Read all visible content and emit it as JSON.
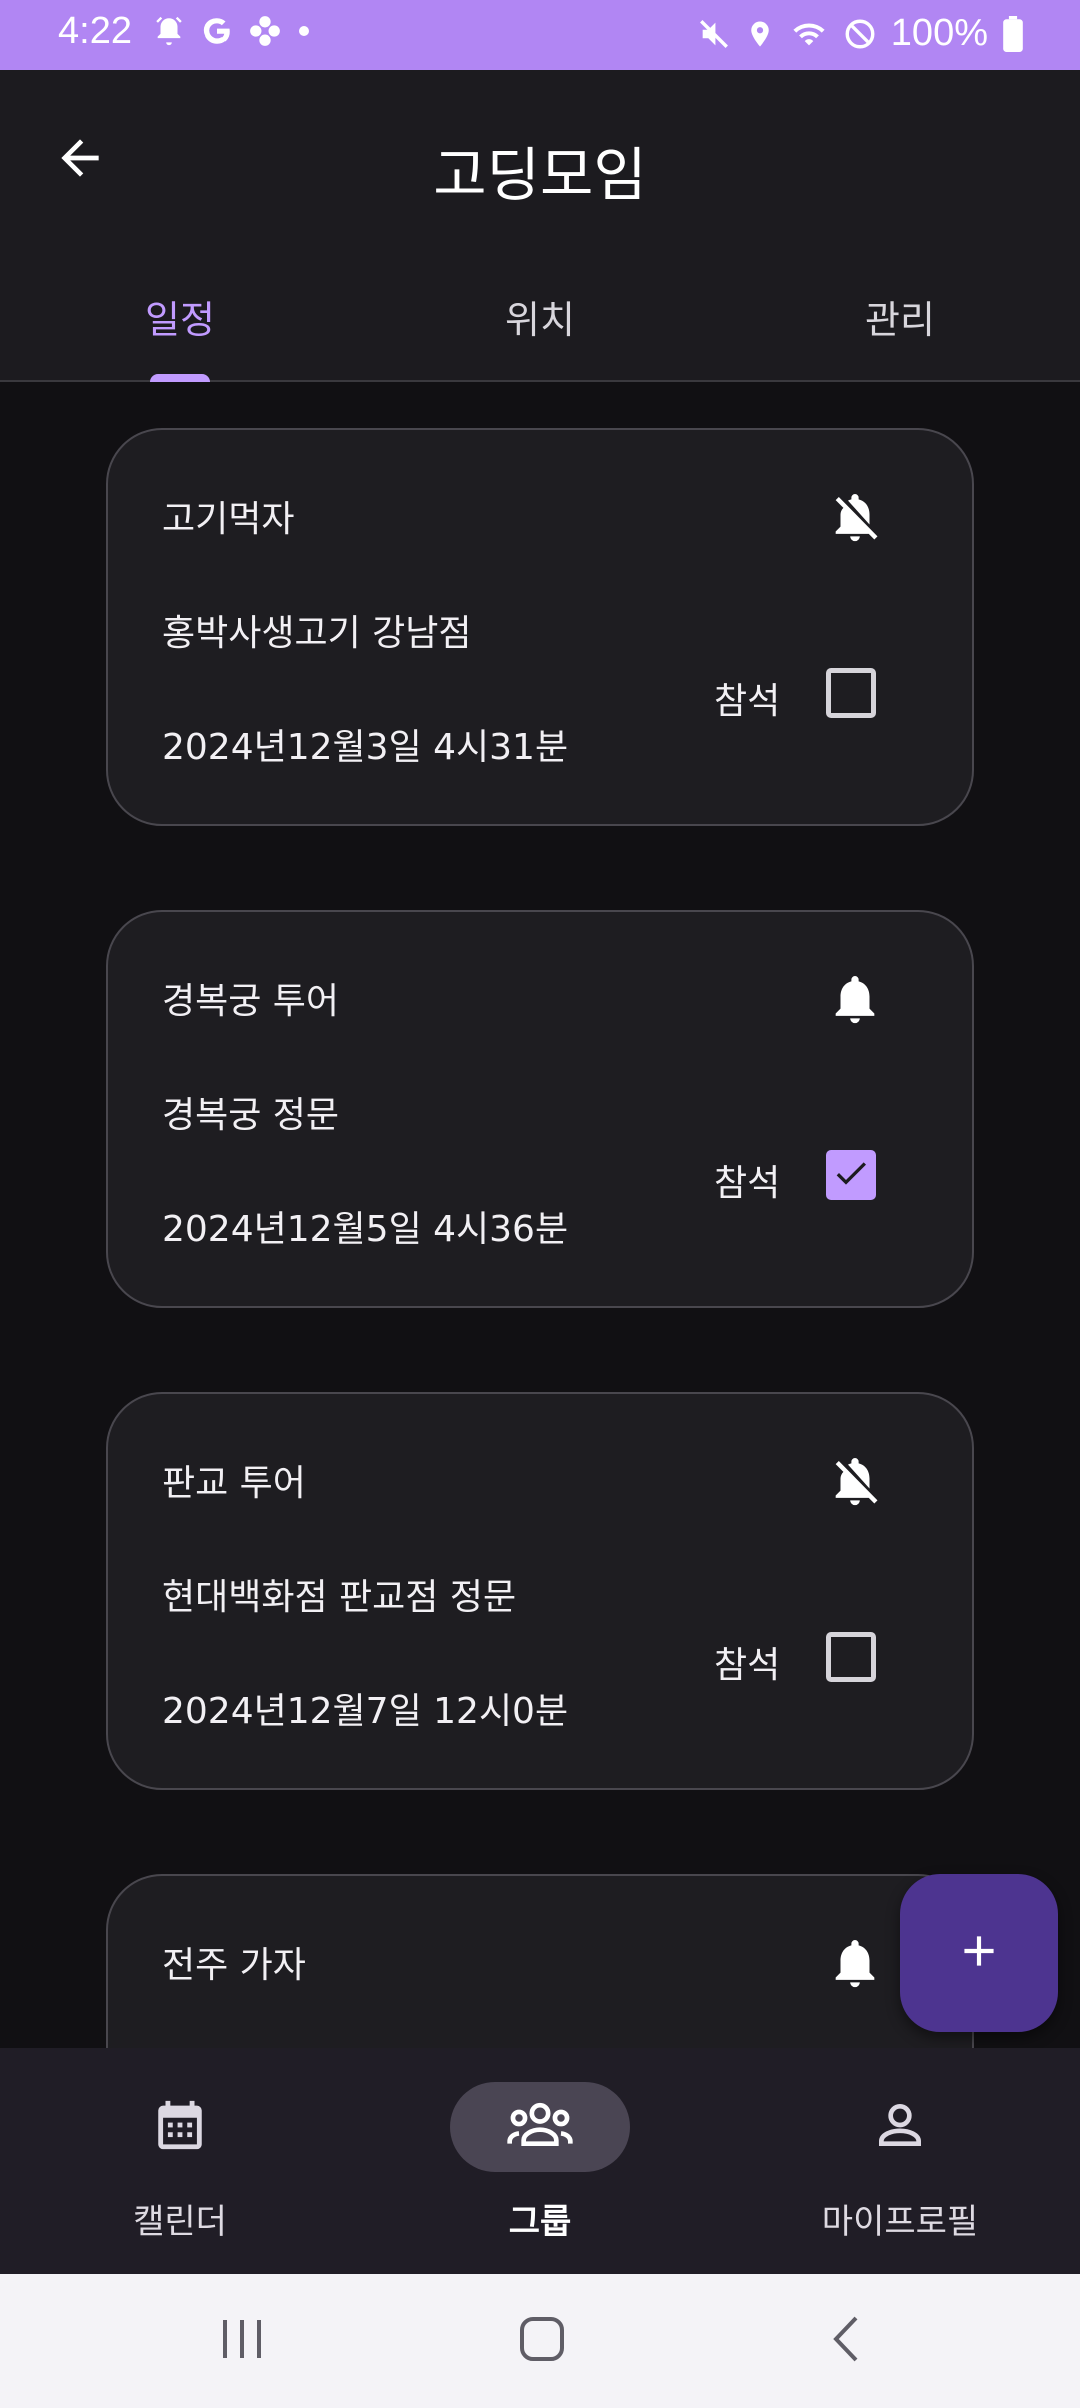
{
  "status_bar": {
    "time": "4:22",
    "battery": "100%",
    "left_icons": [
      "alarm-icon",
      "google-icon",
      "pinwheel-icon",
      "dot-icon"
    ],
    "right_icons": [
      "mute-icon",
      "location-icon",
      "wifi-icon",
      "dnd-icon",
      "battery-icon"
    ]
  },
  "header": {
    "title": "고딩모임",
    "back_icon": "arrow-left-icon"
  },
  "tabs": [
    {
      "label": "일정",
      "active": true
    },
    {
      "label": "위치",
      "active": false
    },
    {
      "label": "관리",
      "active": false
    }
  ],
  "events": [
    {
      "title": "고기먹자",
      "place": "홍박사생고기 강남점",
      "date": "2024년12월3일 4시31분",
      "notify": false,
      "attend_label": "참석",
      "attending": false
    },
    {
      "title": "경복궁 투어",
      "place": "경복궁 정문",
      "date": "2024년12월5일 4시36분",
      "notify": true,
      "attend_label": "참석",
      "attending": true
    },
    {
      "title": "판교 투어",
      "place": "현대백화점 판교점 정문",
      "date": "2024년12월7일 12시0분",
      "notify": false,
      "attend_label": "참석",
      "attending": false
    },
    {
      "title": "전주 가자",
      "place": "",
      "date": "",
      "notify": true,
      "attend_label": "",
      "attending": false
    }
  ],
  "fab": {
    "icon": "plus-icon"
  },
  "bottom_nav": [
    {
      "label": "캘린더",
      "icon": "calendar-icon",
      "active": false
    },
    {
      "label": "그룹",
      "icon": "group-icon",
      "active": true
    },
    {
      "label": "마이프로필",
      "icon": "person-icon",
      "active": false
    }
  ],
  "system_nav": [
    "recents-icon",
    "home-icon",
    "back-icon"
  ],
  "colors": {
    "status_bar": "#b186f3",
    "accent": "#c19bff",
    "fab": "#4d3490",
    "background": "#111013",
    "card": "#1e1d21"
  }
}
